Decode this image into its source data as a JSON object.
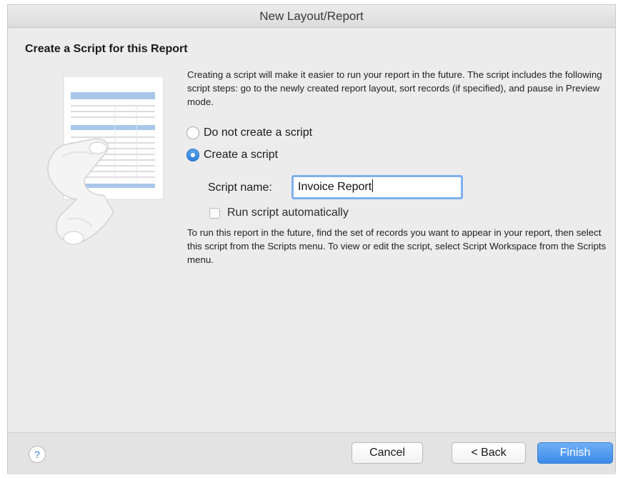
{
  "window": {
    "title": "New Layout/Report"
  },
  "page": {
    "heading": "Create a Script for this Report",
    "intro": "Creating a script will make it easier to run your report in the future. The script includes the following script steps: go to the newly created report layout, sort records (if specified), and pause in Preview mode.",
    "options": [
      {
        "label": "Do not create a script",
        "selected": false
      },
      {
        "label": "Create a script",
        "selected": true
      }
    ],
    "script_name_label": "Script name:",
    "script_name_value": "Invoice Report",
    "run_auto_label": "Run script automatically",
    "run_auto_checked": false,
    "footnote": "To run this report in the future, find the set of records you want to appear in your report, then select this script from the Scripts menu. To view or edit the script, select Script Workspace from the Scripts menu."
  },
  "footer": {
    "help_icon": "?",
    "cancel_label": "Cancel",
    "back_label": "< Back",
    "finish_label": "Finish"
  },
  "colors": {
    "accent": "#3b8ae8",
    "window_bg": "#ececec"
  }
}
